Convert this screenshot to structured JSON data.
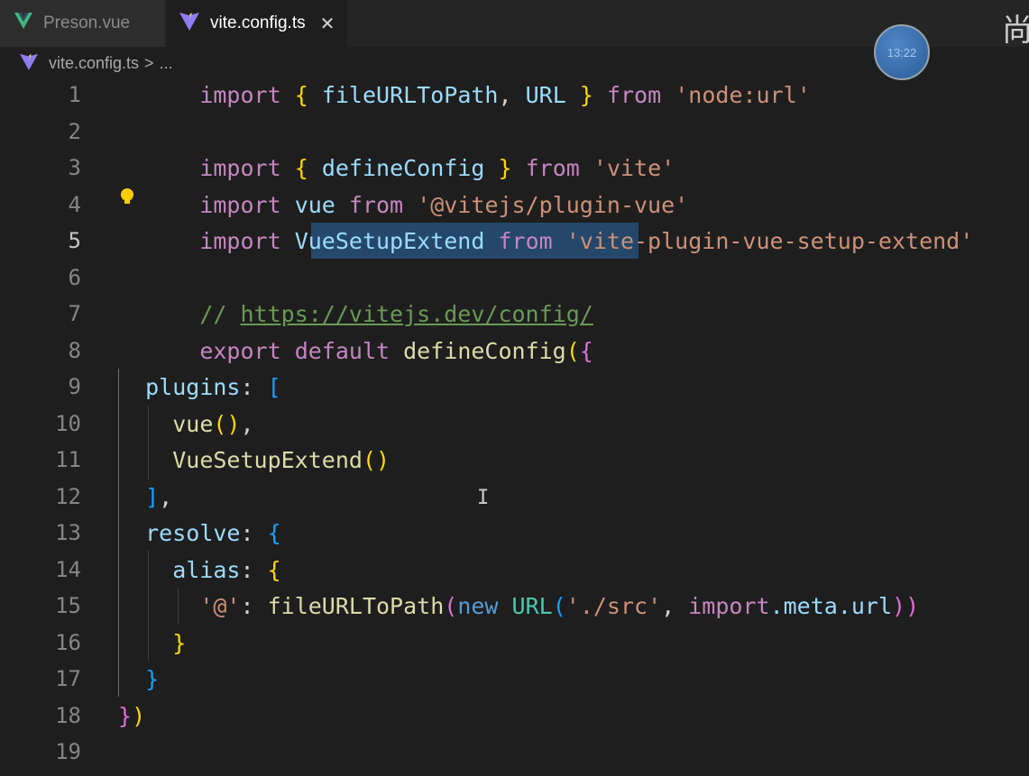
{
  "tabs": [
    {
      "label": "Preson.vue",
      "icon": "vue-icon",
      "active": false
    },
    {
      "label": "vite.config.ts",
      "icon": "vue-icon",
      "active": true,
      "close": "✕"
    }
  ],
  "corner_text": "尚",
  "breadcrumb": {
    "file": "vite.config.ts",
    "separator": ">",
    "rest": "..."
  },
  "clock": {
    "time": "13:22"
  },
  "line_numbers": [
    "1",
    "2",
    "3",
    "4",
    "5",
    "6",
    "7",
    "8",
    "9",
    "10",
    "11",
    "12",
    "13",
    "14",
    "15",
    "16",
    "17",
    "18",
    "19"
  ],
  "code": {
    "l1": {
      "import": "import",
      "ob": "{",
      "a": "fileURLToPath",
      "comma": ",",
      "b": "URL",
      "cb": "}",
      "from": "from",
      "str": "'node:url'"
    },
    "l3": {
      "import": "import",
      "ob": "{",
      "a": "defineConfig",
      "cb": "}",
      "from": "from",
      "str": "'vite'"
    },
    "l4": {
      "import": "import",
      "a": "vue",
      "from": "from",
      "str": "'@vitejs/plugin-vue'"
    },
    "l5": {
      "import": "import",
      "a": "VueSetupExtend",
      "from": "from",
      "str": "'vite-plugin-vue-setup-extend'"
    },
    "l7": {
      "slashes": "//",
      "url": "https://vitejs.dev/config/"
    },
    "l8": {
      "export": "export",
      "default": "default",
      "fn": "defineConfig",
      "op": "(",
      "ob": "{"
    },
    "l9": {
      "key": "plugins",
      "colon": ":",
      "ob": "["
    },
    "l10": {
      "fn": "vue",
      "parens": "()",
      "comma": ","
    },
    "l11": {
      "fn": "VueSetupExtend",
      "parens": "()"
    },
    "l12": {
      "cb": "]",
      "comma": ","
    },
    "l13": {
      "key": "resolve",
      "colon": ":",
      "ob": "{"
    },
    "l14": {
      "key": "alias",
      "colon": ":",
      "ob": "{"
    },
    "l15": {
      "key": "'@'",
      "colon": ":",
      "fn": "fileURLToPath",
      "op": "(",
      "new": "new",
      "cls": "URL",
      "op2": "(",
      "str": "'./src'",
      "comma": ",",
      "import": "import",
      "rest": ".meta.url",
      "cp": "))"
    },
    "l16": {
      "cb": "}"
    },
    "l17": {
      "cb": "}"
    },
    "l18": {
      "cb": "}",
      "cp": ")"
    }
  }
}
